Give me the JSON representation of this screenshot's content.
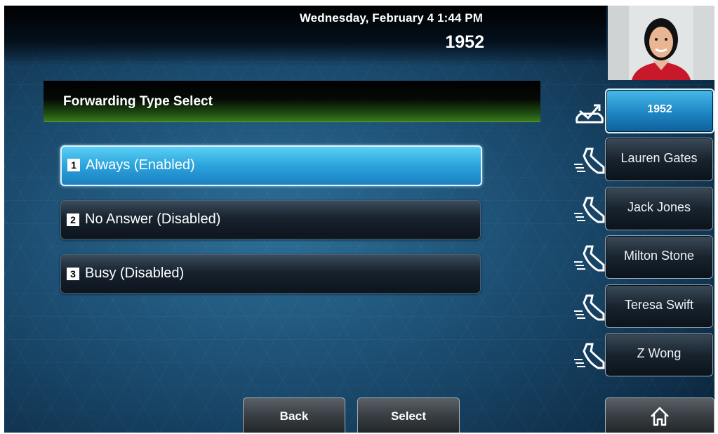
{
  "status": {
    "datetime": "Wednesday, February 4  1:44 PM",
    "extension": "1952"
  },
  "header": {
    "title": "Forwarding Type Select"
  },
  "options": [
    {
      "num": "1",
      "label": "Always (Enabled)",
      "selected": true
    },
    {
      "num": "2",
      "label": "No Answer (Disabled)",
      "selected": false
    },
    {
      "num": "3",
      "label": "Busy (Disabled)",
      "selected": false
    }
  ],
  "line_keys": [
    {
      "label": "1952",
      "icon": "phone-forwarding-icon",
      "active": true
    },
    {
      "label": "Lauren Gates",
      "icon": "phone-contact-icon",
      "active": false
    },
    {
      "label": "Jack Jones",
      "icon": "phone-contact-icon",
      "active": false
    },
    {
      "label": "Milton Stone",
      "icon": "phone-contact-icon",
      "active": false
    },
    {
      "label": "Teresa Swift",
      "icon": "phone-contact-icon",
      "active": false
    },
    {
      "label": "Z Wong",
      "icon": "phone-contact-icon",
      "active": false
    }
  ],
  "softkeys": {
    "back": "Back",
    "select": "Select",
    "home_icon": "home-icon"
  },
  "colors": {
    "selected_option": "#2ca3dc",
    "header_green": "#3a7a1e",
    "background": "#1c4e72"
  }
}
